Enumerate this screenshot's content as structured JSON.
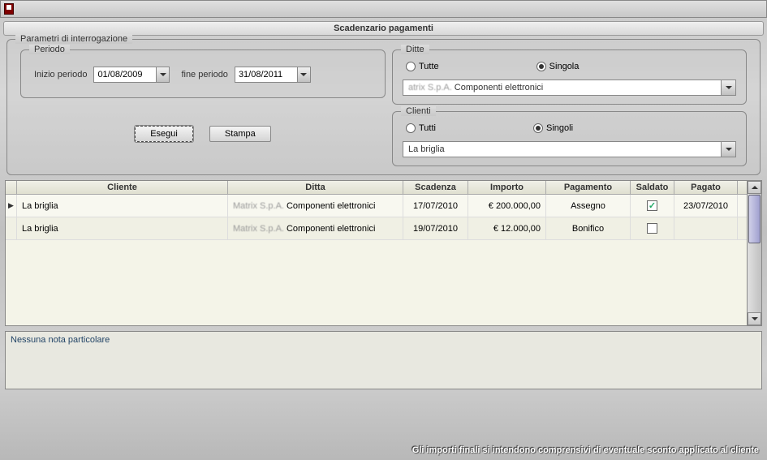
{
  "window_title": "Scadenzario pagamenti",
  "params": {
    "legend": "Parametri di interrogazione",
    "periodo": {
      "legend": "Periodo",
      "start_label": "Inizio periodo",
      "start_value": "01/08/2009",
      "end_label": "fine periodo",
      "end_value": "31/08/2011"
    },
    "buttons": {
      "esegui": "Esegui",
      "stampa": "Stampa"
    },
    "ditte": {
      "legend": "Ditte",
      "opt_all": "Tutte",
      "opt_single": "Singola",
      "selected": "single",
      "combo_prefix": "atrix S.p.A.",
      "combo_suffix": "Componenti elettronici"
    },
    "clienti": {
      "legend": "Clienti",
      "opt_all": "Tutti",
      "opt_single": "Singoli",
      "selected": "single",
      "combo_value": "La briglia"
    }
  },
  "grid": {
    "headers": {
      "cliente": "Cliente",
      "ditta": "Ditta",
      "scadenza": "Scadenza",
      "importo": "Importo",
      "pagamento": "Pagamento",
      "saldato": "Saldato",
      "pagato": "Pagato"
    },
    "rows": [
      {
        "cliente": "La briglia",
        "ditta_prefix": "Matrix S.p.A.",
        "ditta_suffix": "Componenti elettronici",
        "scadenza": "17/07/2010",
        "importo": "€ 200.000,00",
        "pagamento": "Assegno",
        "saldato": true,
        "pagato": "23/07/2010"
      },
      {
        "cliente": "La briglia",
        "ditta_prefix": "Matrix S.p.A.",
        "ditta_suffix": "Componenti elettronici",
        "scadenza": "19/07/2010",
        "importo": "€ 12.000,00",
        "pagamento": "Bonifico",
        "saldato": false,
        "pagato": ""
      }
    ]
  },
  "notes": "Nessuna nota particolare",
  "footer": "Gli importi finali si intendono comprensivi di eventuale sconto applicato al cliente"
}
